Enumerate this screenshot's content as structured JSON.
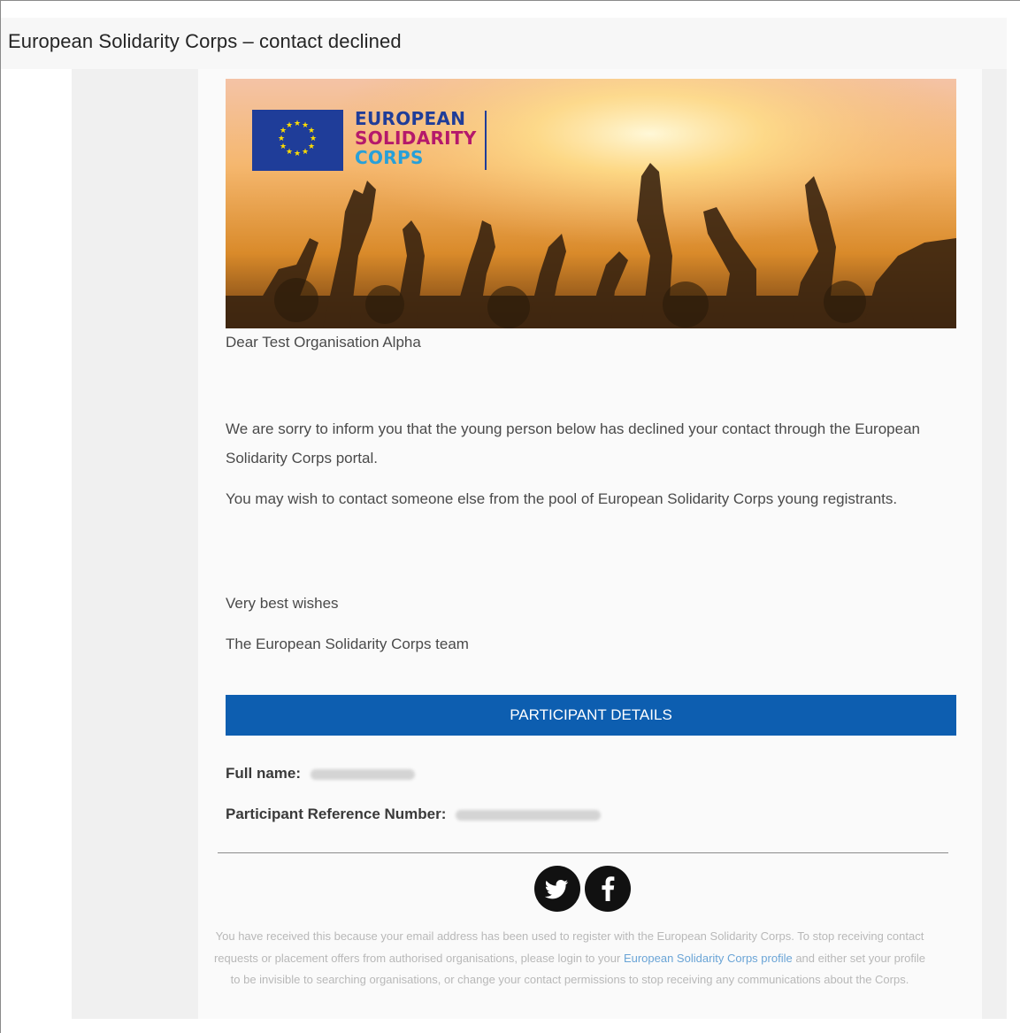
{
  "window": {
    "title": "European Solidarity Corps – contact declined"
  },
  "banner": {
    "logo_lines": [
      "EUROPEAN",
      "SOLIDARITY",
      "CORPS"
    ],
    "logo_colors": [
      "#1f3d99",
      "#b5196b",
      "#27a0d9"
    ],
    "flag_color": "#1f3d99",
    "star_color": "#ffdd00"
  },
  "email": {
    "greeting": "Dear Test Organisation Alpha",
    "paragraph1": "We are sorry to inform you that the young person below has declined your contact through the European Solidarity Corps portal.",
    "paragraph2": "You may wish to contact someone else from the pool of European Solidarity Corps young registrants.",
    "closing": "Very best wishes",
    "signature": "The European Solidarity Corps team"
  },
  "participant": {
    "section_title": "PARTICIPANT DETAILS",
    "section_color": "#0d5eb0",
    "full_name_label": "Full name:",
    "reference_label": "Participant Reference Number:"
  },
  "social": {
    "icons": [
      "twitter-icon",
      "facebook-icon"
    ]
  },
  "footer": {
    "text_before": "You have received this because your email address has been used to register with the European Solidarity Corps. To stop receiving contact requests or placement offers from authorised organisations, please login to your ",
    "link": "European Solidarity Corps profile",
    "text_after": " and either set your profile to be invisible to searching organisations, or change your contact permissions to stop receiving any communications about the Corps."
  }
}
